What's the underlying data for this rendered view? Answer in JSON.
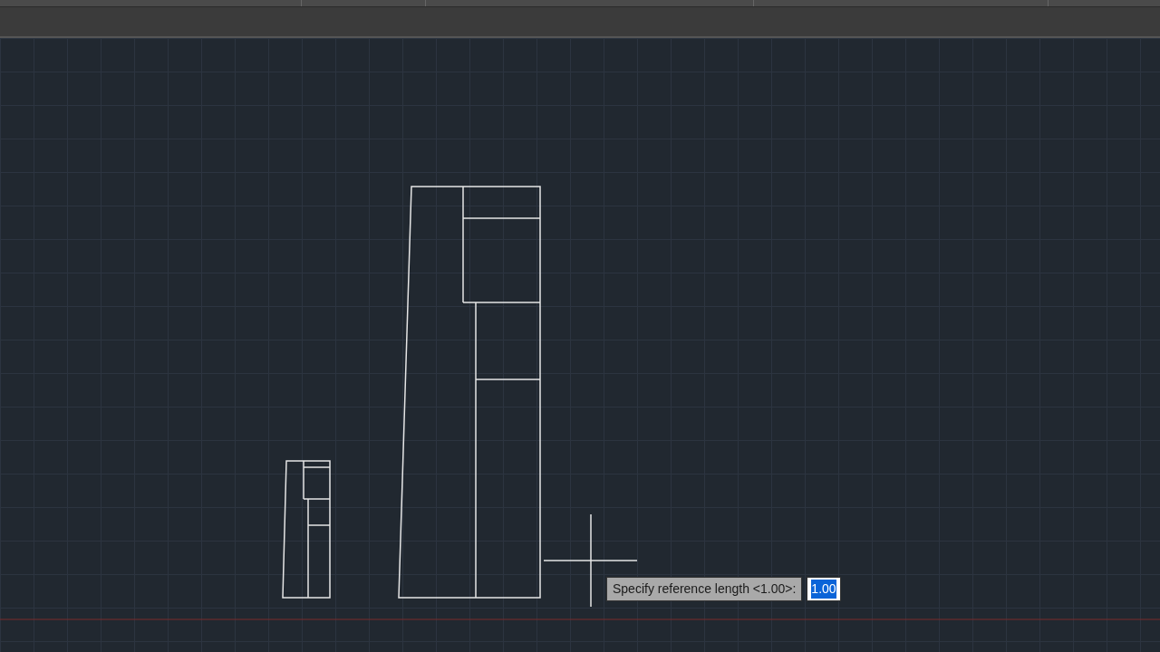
{
  "prompt": {
    "label": "Specify reference length <1.00>:",
    "input": {
      "value": "1.00",
      "selected": true
    }
  }
}
